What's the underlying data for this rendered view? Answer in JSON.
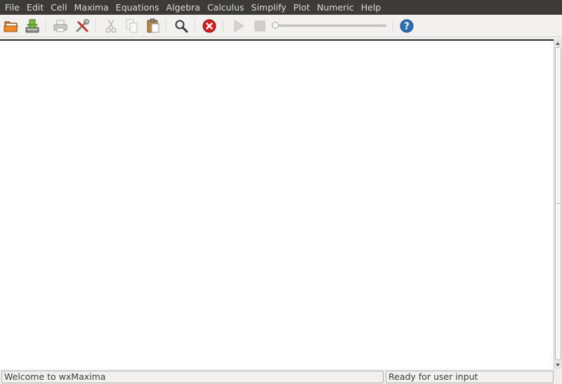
{
  "menubar": {
    "items": [
      "File",
      "Edit",
      "Cell",
      "Maxima",
      "Equations",
      "Algebra",
      "Calculus",
      "Simplify",
      "Plot",
      "Numeric",
      "Help"
    ]
  },
  "toolbar": {
    "buttons": [
      "open-icon",
      "save-icon",
      "print-icon",
      "preferences-icon",
      "cut-icon",
      "copy-icon",
      "paste-icon",
      "find-icon",
      "interrupt-icon",
      "play-icon",
      "stop-icon",
      "help-icon"
    ],
    "animation_slider": {
      "value": 0
    },
    "colors": {
      "accent_orange": "#e06b1a",
      "save_green": "#6aa33a",
      "interrupt_red": "#d42020",
      "help_blue": "#2f6fb5"
    }
  },
  "statusbar": {
    "left_text": "Welcome to wxMaxima",
    "right_text": "Ready for user input"
  }
}
